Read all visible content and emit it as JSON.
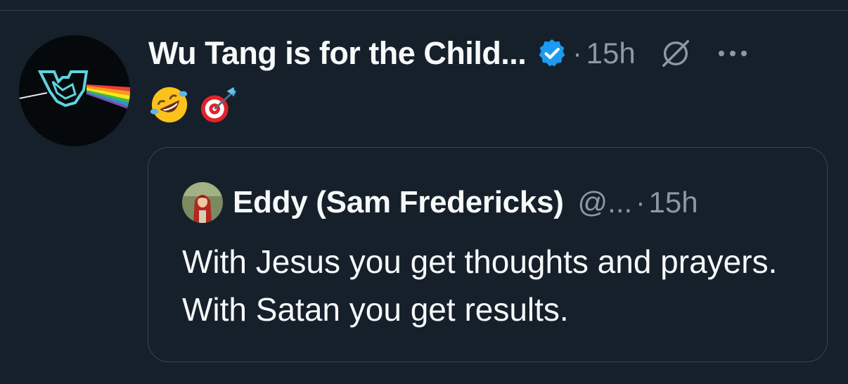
{
  "tweet": {
    "author_name": "Wu Tang is for the Child...",
    "verified": true,
    "dot": "·",
    "timestamp": "15h",
    "emojis": [
      "rolling-on-floor-laughing",
      "direct-hit"
    ]
  },
  "quote": {
    "author_name": "Eddy (Sam Fredericks)",
    "handle": "@...",
    "dot": "·",
    "timestamp": "15h",
    "text": "With Jesus you get thoughts and prayers. With Satan you get results."
  },
  "colors": {
    "background": "#15202b",
    "border": "#38444d",
    "secondary_text": "#8b98a5",
    "verified_blue": "#1d9bf0"
  }
}
